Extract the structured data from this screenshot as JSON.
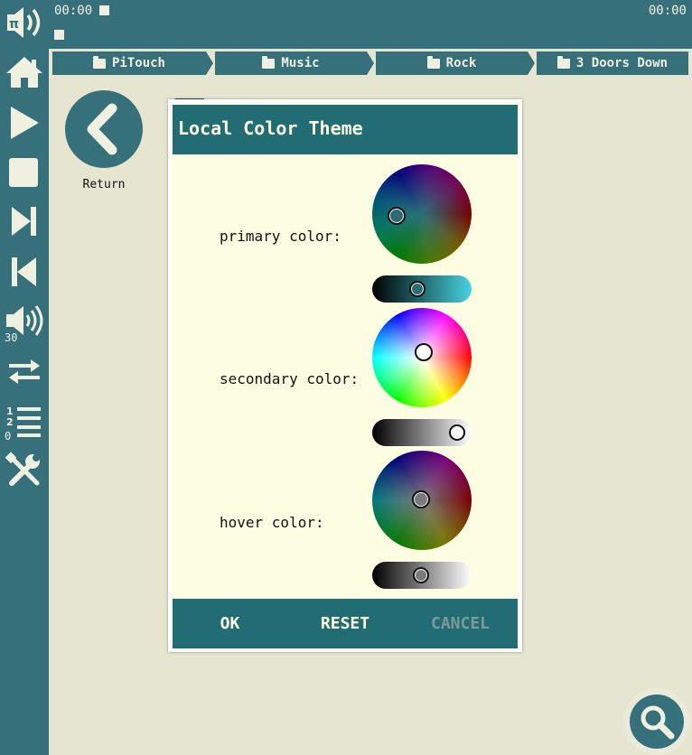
{
  "status": {
    "time_left": "00:00",
    "time_right": "00:00"
  },
  "sidebar": {
    "items": [
      {
        "name": "logo-volume-icon"
      },
      {
        "name": "home-icon"
      },
      {
        "name": "play-icon"
      },
      {
        "name": "stop-icon"
      },
      {
        "name": "next-track-icon"
      },
      {
        "name": "previous-track-icon"
      },
      {
        "name": "volume-icon",
        "badge": "30"
      },
      {
        "name": "repeat-icon"
      },
      {
        "name": "playlist-icon",
        "badge": "0"
      },
      {
        "name": "settings-tools-icon"
      }
    ],
    "volume_badge": "30",
    "playlist_badge": "0"
  },
  "breadcrumb": {
    "items": [
      "PiTouch",
      "Music",
      "Rock",
      "3 Doors Down"
    ]
  },
  "browser": {
    "return_label": "Return",
    "peek_label": ":"
  },
  "dialog": {
    "title": "Local Color Theme",
    "rows": [
      {
        "label": "primary color:",
        "wheel_type": "dim-hue-wheel",
        "slider_value": 0.45
      },
      {
        "label": "secondary color:",
        "wheel_type": "bright-hue-wheel",
        "slider_value": 0.95
      },
      {
        "label": "hover color:",
        "wheel_type": "dim-hue-wheel",
        "slider_value": 0.5
      }
    ],
    "buttons": {
      "ok": "OK",
      "reset": "RESET",
      "cancel": "CANCEL"
    }
  },
  "colors": {
    "bar": "#36707a",
    "dialog_header": "#226d74",
    "dialog_bg": "#fdfde2",
    "page_bg": "#e5e5d0",
    "primary_knob": "#2d6a74",
    "secondary_knob": "#ffffff",
    "hover_knob": "#7a7a7a",
    "primary_slider_end": "#46d3df"
  },
  "fab": {
    "icon": "search-icon"
  }
}
